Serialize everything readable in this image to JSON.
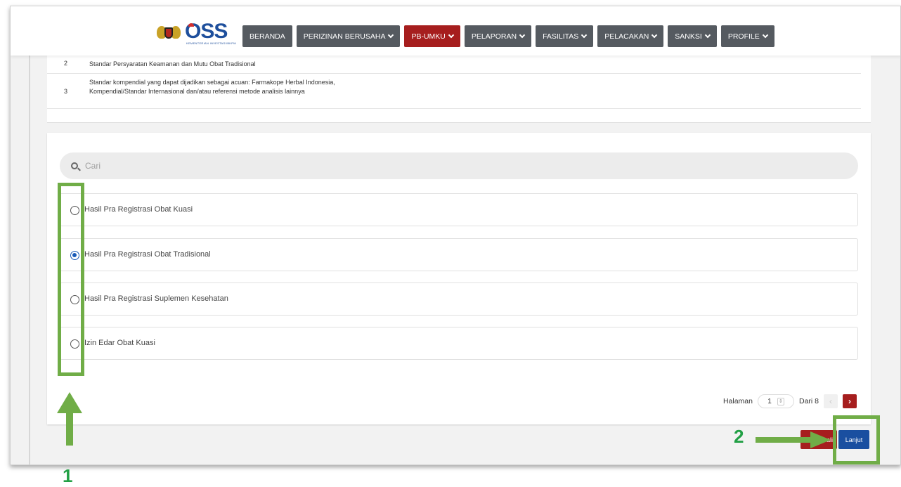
{
  "header": {
    "logo_text": "OSS",
    "logo_subtext": "KEMENTERIAN INVESTASI/BKPM",
    "nav": [
      {
        "label": "BERANDA",
        "has_dropdown": false,
        "active": false
      },
      {
        "label": "PERIZINAN BERUSAHA",
        "has_dropdown": true,
        "active": false
      },
      {
        "label": "PB-UMKU",
        "has_dropdown": true,
        "active": true
      },
      {
        "label": "PELAPORAN",
        "has_dropdown": true,
        "active": false
      },
      {
        "label": "FASILITAS",
        "has_dropdown": true,
        "active": false
      },
      {
        "label": "PELACAKAN",
        "has_dropdown": true,
        "active": false
      },
      {
        "label": "SANKSI",
        "has_dropdown": true,
        "active": false
      },
      {
        "label": "PROFILE",
        "has_dropdown": true,
        "active": false
      }
    ]
  },
  "requirements_table": {
    "rows": [
      {
        "no": "2",
        "text": "Standar Persyaratan Keamanan dan Mutu Obat Tradisional"
      },
      {
        "no": "3",
        "text": "Standar kompendial yang dapat dijadikan sebagai acuan: Farmakope Herbal Indonesia, Kompendial/Standar Internasional dan/atau referensi metode analisis lainnya"
      }
    ]
  },
  "search": {
    "placeholder": "Cari",
    "icon": "search-icon"
  },
  "options": [
    {
      "label": "Hasil Pra Registrasi Obat Kuasi",
      "checked": false
    },
    {
      "label": "Hasil Pra Registrasi Obat Tradisional",
      "checked": true
    },
    {
      "label": "Hasil Pra Registrasi Suplemen Kesehatan",
      "checked": false
    },
    {
      "label": "Izin Edar Obat Kuasi",
      "checked": false
    }
  ],
  "pagination": {
    "label": "Halaman",
    "current": "1",
    "total_label": "Dari 8",
    "prev": "‹",
    "next": "›"
  },
  "actions": {
    "back_label": "ali",
    "next_label": "Lanjut"
  },
  "annotations": {
    "step1": "1",
    "step2": "2",
    "color": "#70ad47",
    "number_color": "#22a045"
  },
  "colors": {
    "active_nav": "#a61e1e",
    "nav": "#555a60",
    "primary": "#1a4fa0",
    "danger": "#a61e1e"
  }
}
